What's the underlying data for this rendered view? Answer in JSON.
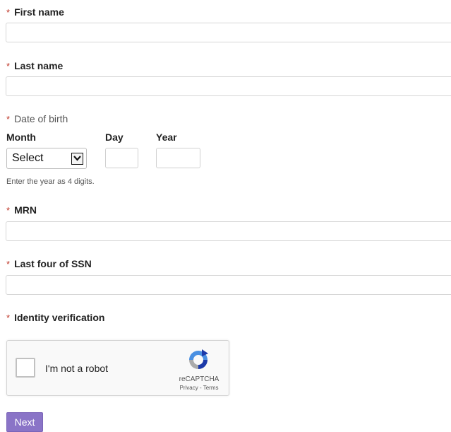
{
  "required_marker": "*",
  "fields": {
    "first_name": {
      "label": "First name",
      "value": ""
    },
    "last_name": {
      "label": "Last name",
      "value": ""
    },
    "date_of_birth": {
      "label": "Date of birth",
      "month_label": "Month",
      "day_label": "Day",
      "year_label": "Year",
      "month_value": "Select",
      "day_value": "",
      "year_value": "",
      "hint": "Enter the year as 4 digits."
    },
    "mrn": {
      "label": "MRN",
      "value": ""
    },
    "ssn_last_four": {
      "label": "Last four of SSN",
      "value": ""
    },
    "identity_verification": {
      "label": "Identity verification"
    }
  },
  "recaptcha": {
    "checkbox_label": "I'm not a robot",
    "brand": "reCAPTCHA",
    "links": "Privacy - Terms"
  },
  "next_button": {
    "label": "Next"
  },
  "colors": {
    "required": "#c0392b",
    "button": "#8a74c7",
    "input_border": "#d6d6d6"
  },
  "icons": {
    "select_arrow": "chevron-down-icon",
    "recaptcha_logo": "recaptcha-logo-icon"
  }
}
